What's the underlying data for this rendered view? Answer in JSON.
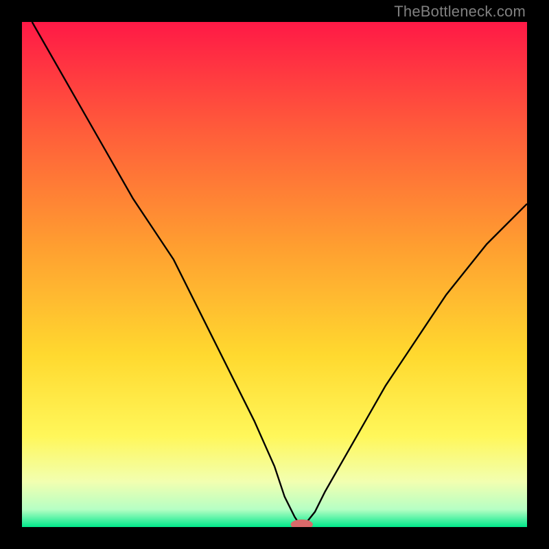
{
  "watermark": "TheBottleneck.com",
  "colors": {
    "black": "#000000",
    "grad_top": "#ff1a3f",
    "grad_mid1": "#ffa030",
    "grad_mid2": "#ffe232",
    "grad_pale": "#f6ffc4",
    "grad_bot": "#00e88b",
    "curve": "#000000",
    "marker_fill": "#d96a6a"
  },
  "chart_data": {
    "type": "line",
    "title": "",
    "xlabel": "",
    "ylabel": "",
    "xlim": [
      0,
      100
    ],
    "ylim": [
      0,
      100
    ],
    "series": [
      {
        "name": "bottleneck-curve",
        "x": [
          2,
          6,
          10,
          14,
          18,
          22,
          26,
          30,
          34,
          38,
          42,
          46,
          50,
          52,
          54,
          55,
          56,
          58,
          60,
          64,
          68,
          72,
          76,
          80,
          84,
          88,
          92,
          96,
          100
        ],
        "y": [
          100,
          93,
          86,
          79,
          72,
          65,
          59,
          53,
          45,
          37,
          29,
          21,
          12,
          6,
          2,
          0.5,
          0.5,
          3,
          7,
          14,
          21,
          28,
          34,
          40,
          46,
          51,
          56,
          60,
          64
        ]
      }
    ],
    "marker": {
      "x": 55.4,
      "y": 0.5,
      "rx": 2.2,
      "ry": 1.0,
      "color": "#d96a6a"
    },
    "background_gradient_stops": [
      {
        "offset": 0.0,
        "color": "#ff1946"
      },
      {
        "offset": 0.22,
        "color": "#ff5e3a"
      },
      {
        "offset": 0.45,
        "color": "#ffa030"
      },
      {
        "offset": 0.66,
        "color": "#ffd92f"
      },
      {
        "offset": 0.82,
        "color": "#fff75a"
      },
      {
        "offset": 0.91,
        "color": "#f2ffb0"
      },
      {
        "offset": 0.965,
        "color": "#b6ffc4"
      },
      {
        "offset": 1.0,
        "color": "#00e88b"
      }
    ]
  }
}
